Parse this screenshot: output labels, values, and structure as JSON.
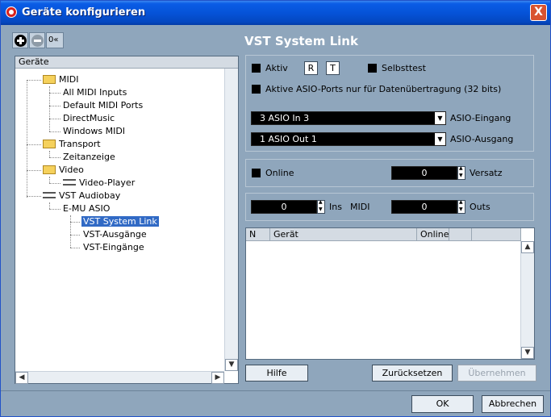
{
  "window": {
    "title": "Geräte konfigurieren",
    "close_label": "X"
  },
  "toolbar": {
    "add_icon": "plus-circle-icon",
    "remove_icon": "minus-circle-icon",
    "reset_label": "0«"
  },
  "heading": "VST System Link",
  "tree": {
    "header": "Geräte",
    "items": [
      {
        "label": "MIDI"
      },
      {
        "label": "All MIDI Inputs"
      },
      {
        "label": "Default MIDI Ports"
      },
      {
        "label": "DirectMusic"
      },
      {
        "label": "Windows MIDI"
      },
      {
        "label": "Transport"
      },
      {
        "label": "Zeitanzeige"
      },
      {
        "label": "Video"
      },
      {
        "label": "Video-Player"
      },
      {
        "label": "VST Audiobay"
      },
      {
        "label": "E-MU ASIO"
      },
      {
        "label": "VST System Link"
      },
      {
        "label": "VST-Ausgänge"
      },
      {
        "label": "VST-Eingänge"
      }
    ]
  },
  "settings": {
    "aktiv": "Aktiv",
    "r": "R",
    "t": "T",
    "selbsttest": "Selbsttest",
    "asio_ports": "Aktive ASIO-Ports nur für Datenübertragung (32 bits)",
    "asio_in_value": "3 ASIO In 3",
    "asio_in_label": "ASIO-Eingang",
    "asio_out_value": "1 ASIO Out 1",
    "asio_out_label": "ASIO-Ausgang",
    "online": "Online",
    "versatz_value": "0",
    "versatz_label": "Versatz",
    "ins_value": "0",
    "ins_label": "Ins",
    "midi_label": "MIDI",
    "outs_value": "0",
    "outs_label": "Outs"
  },
  "table": {
    "columns": [
      "N",
      "Gerät",
      "Online"
    ]
  },
  "buttons": {
    "hilfe": "Hilfe",
    "zuruecksetzen": "Zurücksetzen",
    "uebernehmen": "Übernehmen",
    "ok": "OK",
    "abbrechen": "Abbrechen"
  }
}
